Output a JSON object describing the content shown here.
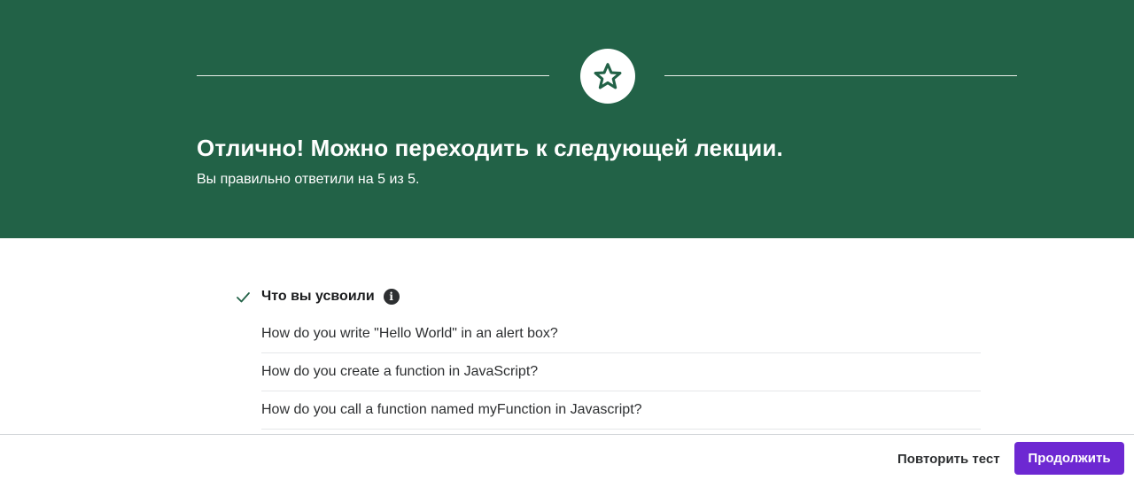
{
  "banner": {
    "title": "Отлично! Можно переходить к следующей лекции.",
    "subtitle": "Вы правильно ответили на 5 из 5.",
    "icon": "star-icon",
    "background_color": "#226247"
  },
  "learned": {
    "title": "Что вы усвоили",
    "check_icon": "check-icon",
    "info_icon": "info-icon",
    "items": [
      "How do you write \"Hello World\" in an alert box?",
      "How do you create a function in JavaScript?",
      "How do you call a function named myFunction in Javascript?"
    ]
  },
  "footer": {
    "retry_label": "Повторить тест",
    "continue_label": "Продолжить",
    "accent_color": "#6d28d2"
  }
}
